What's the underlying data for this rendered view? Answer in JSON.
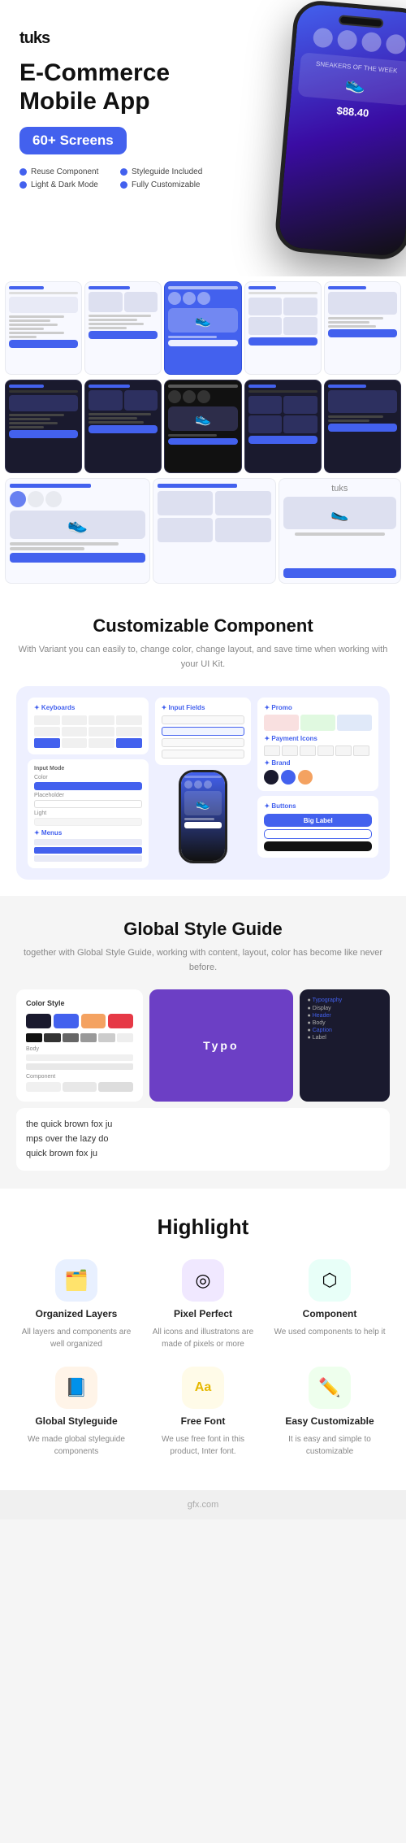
{
  "brand": {
    "name": "tuks",
    "tagline_accent": "."
  },
  "hero": {
    "title": "E-Commerce\nMobile App",
    "badge_number": "60+",
    "badge_label": "Screens",
    "features": [
      "Reuse Component",
      "Styleguide Included",
      "Light & Dark Mode",
      "Fully Customizable"
    ],
    "phone_price": "$88.40"
  },
  "sections": {
    "customizable": {
      "title": "Customizable Component",
      "subtitle": "With Variant you can easily to, change color, change layout, and save time\nwhen working with your UI Kit.",
      "panels": {
        "keyboards_label": "✦ Keyboards",
        "input_fields_label": "✦ Input Fields",
        "promo_label": "✦ Promo",
        "payment_icons_label": "✦ Payment Icons",
        "brand_label": "✦ Brand",
        "buttons_label": "✦ Buttons",
        "big_label": "Big Label"
      }
    },
    "styleguide": {
      "title": "Global Style Guide",
      "subtitle": "together with Global Style Guide, working with content, layout, color\nhas become like never before.",
      "color_style_label": "Color Style",
      "typography_label": "Typo",
      "text_sample": "the quick brown fox ju"
    },
    "highlight": {
      "title": "Highlight",
      "items": [
        {
          "icon": "🗂️",
          "icon_bg": "icon-blue",
          "name": "Organized Layers",
          "desc": "All layers and components are well organized"
        },
        {
          "icon": "◎",
          "icon_bg": "icon-purple",
          "name": "Pixel Perfect",
          "desc": "All icons and illustratons are made of pixels or more"
        },
        {
          "icon": "⬡",
          "icon_bg": "icon-teal",
          "name": "Component",
          "desc": "We used components to help it"
        },
        {
          "icon": "📘",
          "icon_bg": "icon-orange",
          "name": "Global Styleguide",
          "desc": "We made global styleguide components"
        },
        {
          "icon": "Aa",
          "icon_bg": "icon-yellow",
          "name": "Free Font",
          "desc": "We use free font in this product, Inter font."
        },
        {
          "icon": "✏️",
          "icon_bg": "icon-green",
          "name": "Easy Customizable",
          "desc": "It is easy and simple to customizable"
        }
      ]
    }
  },
  "footer": {
    "text": "gfx.com"
  },
  "colors": {
    "accent": "#4361ee",
    "dark": "#1a1a2e",
    "text": "#111111",
    "muted": "#888888",
    "bg_light": "#f5f5f5"
  }
}
